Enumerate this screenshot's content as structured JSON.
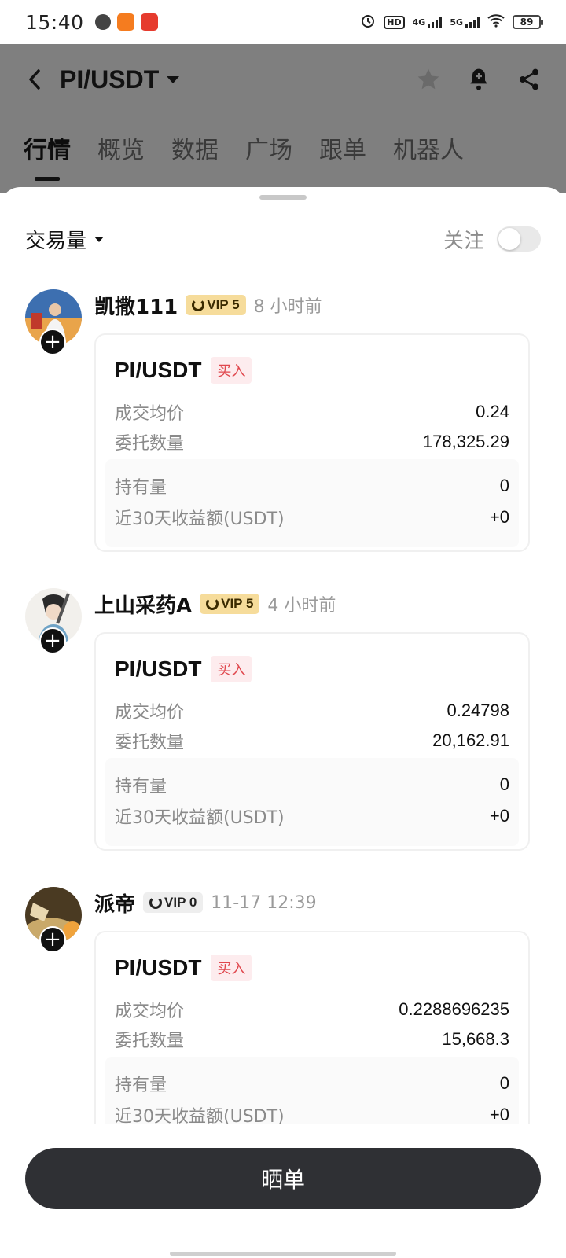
{
  "status_bar": {
    "time": "15:40",
    "battery": "89",
    "network_labels": [
      "HD",
      "4G",
      "5G"
    ]
  },
  "header": {
    "title": "PI/USDT",
    "icons": [
      "back-icon",
      "caret-down-icon",
      "star-icon",
      "bell-icon",
      "share-icon"
    ]
  },
  "tabs": [
    "行情",
    "概览",
    "数据",
    "广场",
    "跟单",
    "机器人"
  ],
  "filter": {
    "sort_label": "交易量",
    "follow_label": "关注",
    "follow_enabled": false
  },
  "posts": [
    {
      "username": "凯撒111",
      "vip": "VIP 5",
      "time": "8 小时前",
      "pair": "PI/USDT",
      "side": "买入",
      "avg_price_label": "成交均价",
      "avg_price": "0.24",
      "qty_label": "委托数量",
      "qty": "178,325.29",
      "holding_label": "持有量",
      "holding": "0",
      "pnl_label": "近30天收益额(USDT)",
      "pnl": "+0"
    },
    {
      "username": "上山采药A",
      "vip": "VIP 5",
      "time": "4 小时前",
      "pair": "PI/USDT",
      "side": "买入",
      "avg_price_label": "成交均价",
      "avg_price": "0.24798",
      "qty_label": "委托数量",
      "qty": "20,162.91",
      "holding_label": "持有量",
      "holding": "0",
      "pnl_label": "近30天收益额(USDT)",
      "pnl": "+0"
    },
    {
      "username": "派帝",
      "vip": "VIP 0",
      "time": "11-17 12:39",
      "pair": "PI/USDT",
      "side": "买入",
      "avg_price_label": "成交均价",
      "avg_price": "0.2288696235",
      "qty_label": "委托数量",
      "qty": "15,668.3",
      "holding_label": "持有量",
      "holding": "0",
      "pnl_label": "近30天收益额(USDT)",
      "pnl": "+0"
    }
  ],
  "bottom": {
    "button_label": "晒单"
  },
  "colors": {
    "accent_dark": "#2f3034",
    "buy_red": "#e0474d",
    "vip_gold": "#f6dc9b",
    "overlay_gray": "#7f7f7f"
  }
}
